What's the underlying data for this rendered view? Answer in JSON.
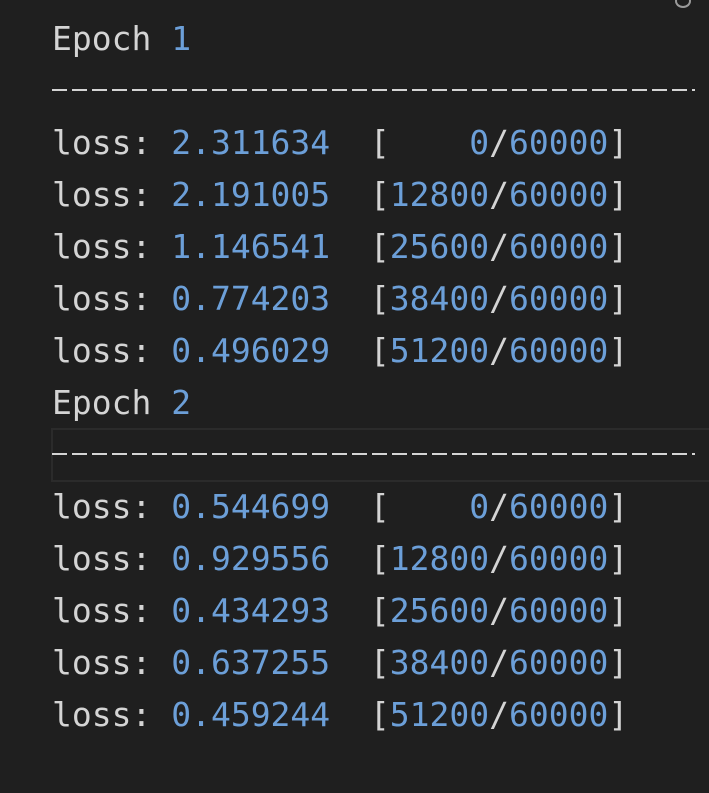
{
  "epochs": [
    {
      "label": "Epoch",
      "number": "1",
      "separator": "--------------------------------",
      "rows": [
        {
          "label": "loss:",
          "value": "2.311634",
          "open": "[",
          "current": "    0",
          "slash": "/",
          "total": "60000",
          "close": "]"
        },
        {
          "label": "loss:",
          "value": "2.191005",
          "open": "[",
          "current": "12800",
          "slash": "/",
          "total": "60000",
          "close": "]"
        },
        {
          "label": "loss:",
          "value": "1.146541",
          "open": "[",
          "current": "25600",
          "slash": "/",
          "total": "60000",
          "close": "]"
        },
        {
          "label": "loss:",
          "value": "0.774203",
          "open": "[",
          "current": "38400",
          "slash": "/",
          "total": "60000",
          "close": "]"
        },
        {
          "label": "loss:",
          "value": "0.496029",
          "open": "[",
          "current": "51200",
          "slash": "/",
          "total": "60000",
          "close": "]"
        }
      ]
    },
    {
      "label": "Epoch",
      "number": "2",
      "separator": "--------------------------------",
      "rows": [
        {
          "label": "loss:",
          "value": "0.544699",
          "open": "[",
          "current": "    0",
          "slash": "/",
          "total": "60000",
          "close": "]"
        },
        {
          "label": "loss:",
          "value": "0.929556",
          "open": "[",
          "current": "12800",
          "slash": "/",
          "total": "60000",
          "close": "]"
        },
        {
          "label": "loss:",
          "value": "0.434293",
          "open": "[",
          "current": "25600",
          "slash": "/",
          "total": "60000",
          "close": "]"
        },
        {
          "label": "loss:",
          "value": "0.637255",
          "open": "[",
          "current": "38400",
          "slash": "/",
          "total": "60000",
          "close": "]"
        },
        {
          "label": "loss:",
          "value": "0.459244",
          "open": "[",
          "current": "51200",
          "slash": "/",
          "total": "60000",
          "close": "]"
        }
      ]
    }
  ],
  "colors": {
    "background": "#1f1f1f",
    "text": "#d4d4d4",
    "number": "#6c9fd8"
  },
  "icons": {
    "top_right": "partial-ring-icon"
  }
}
